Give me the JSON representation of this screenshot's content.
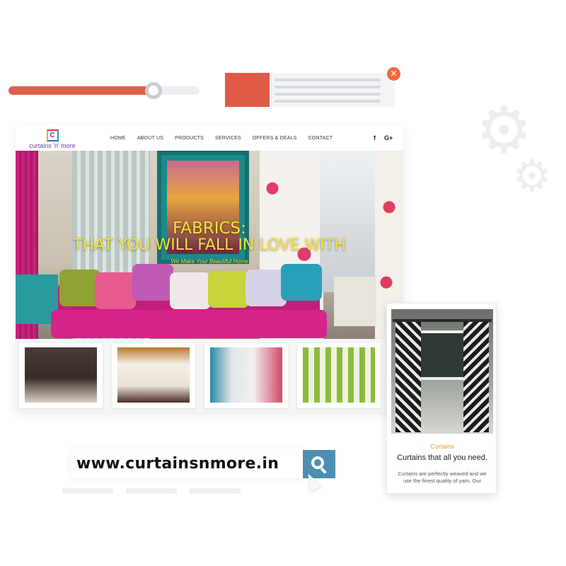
{
  "slider": {
    "value_fraction": 0.76,
    "fill_color": "#e0604f"
  },
  "info_card": {
    "accent_color": "#e05a48",
    "close_icon": "✕"
  },
  "decor_icons": [
    "gear-icon",
    "gear-icon"
  ],
  "site": {
    "logo": {
      "mark": "C",
      "name": "curtains 'n' more"
    },
    "nav": [
      "HOME",
      "ABOUT US",
      "PRODUCTS",
      "SERVICES",
      "OFFERS & DEALS",
      "CONTACT"
    ],
    "social": {
      "facebook": "f",
      "google_plus": "G+"
    },
    "hero": {
      "title_line1": "FABRICS:",
      "title_line2": "THAT YOU WILL FALL IN LOVE WITH",
      "subtitle": "We Make Your Beautiful Home",
      "text_color": "#f2e533"
    },
    "thumbnails": [
      "curtain-photo-1",
      "curtain-photo-2",
      "curtain-photo-3",
      "curtain-photo-4"
    ]
  },
  "mobile_card": {
    "category": "Curtains",
    "title": "Curtains that all you need.",
    "description": "Curtains are perfectly weaved and we use the finest quality of yarn. Our"
  },
  "url_bar": {
    "url": "www.curtainsnmore.in",
    "button_color": "#4d8fb3",
    "search_icon": "search-icon"
  }
}
